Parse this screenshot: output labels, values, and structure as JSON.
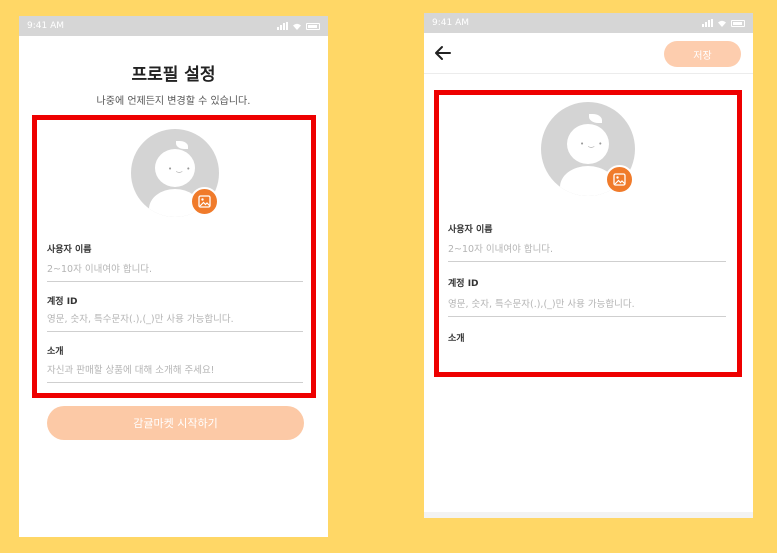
{
  "status_bar": {
    "time": "9:41 AM"
  },
  "left_screen": {
    "title": "프로필 설정",
    "subtitle": "나중에 언제든지 변경할 수 있습니다.",
    "fields": [
      {
        "label": "사용자 이름",
        "placeholder": "2~10자 이내여야 합니다."
      },
      {
        "label": "계정 ID",
        "placeholder": "영문, 숫자, 특수문자(.),(_)만 사용 가능합니다."
      },
      {
        "label": "소개",
        "placeholder": "자신과 판매할 상품에 대해 소개해 주세요!"
      }
    ],
    "start_button": "감귤마켓 시작하기"
  },
  "right_screen": {
    "save_button": "저장",
    "fields": [
      {
        "label": "사용자 이름",
        "placeholder": "2~10자 이내여야 합니다."
      },
      {
        "label": "계정 ID",
        "placeholder": "영문, 숫자, 특수문자(.),(_)만 사용 가능합니다."
      },
      {
        "label": "소개",
        "placeholder": ""
      }
    ]
  },
  "icons": [
    "signal-icon",
    "wifi-icon",
    "battery-icon",
    "back-arrow-icon",
    "image-icon",
    "avatar-icon"
  ],
  "colors": {
    "background": "#FFD766",
    "accent": "#F07B2B",
    "button_disabled": "#FCC9A6",
    "highlight": "#EE0000"
  }
}
